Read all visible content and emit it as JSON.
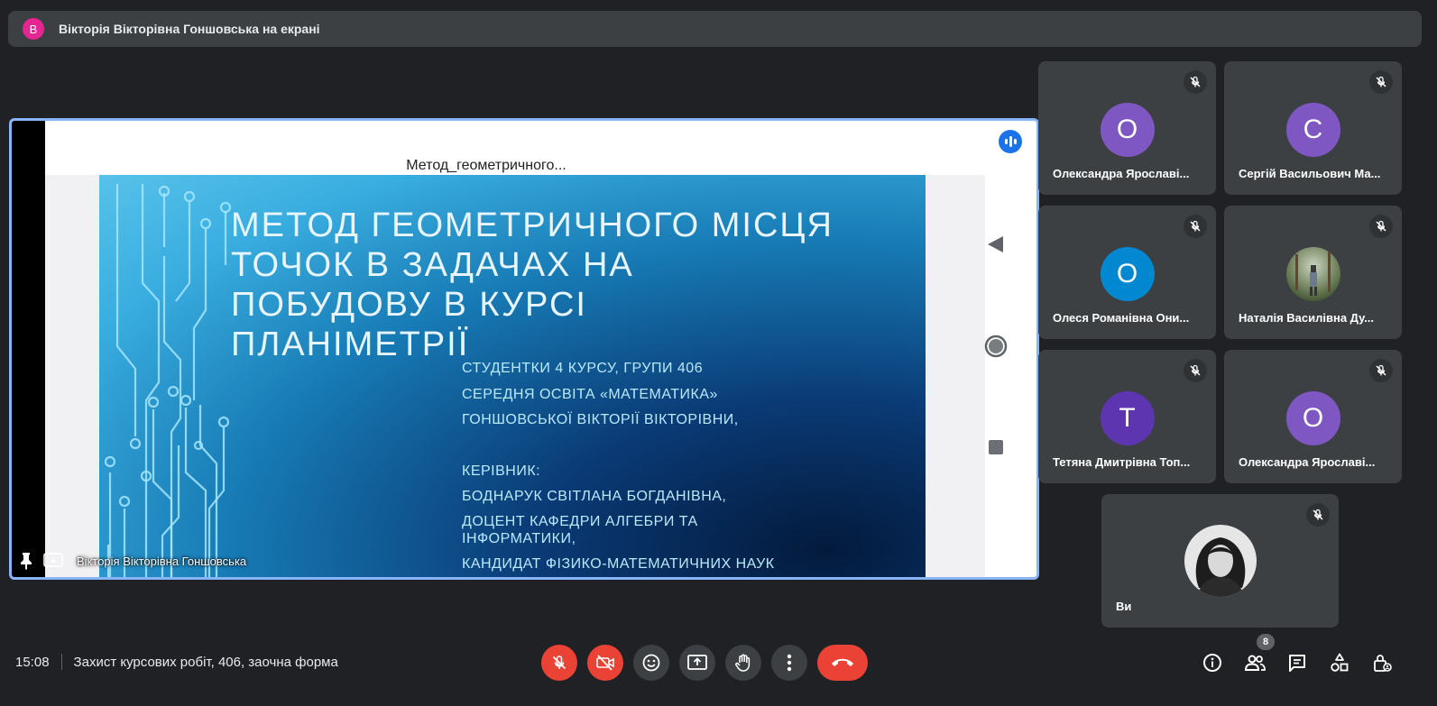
{
  "banner": {
    "avatar_letter": "В",
    "avatar_color": "#e52592",
    "text": "Вікторія Вікторівна Гоншовська на екрані"
  },
  "presentation": {
    "doc_title": "Метод_геометричного...",
    "slide_title_lines": [
      "МЕТОД ГЕОМЕТРИЧНОГО МІСЦЯ",
      "ТОЧОК В ЗАДАЧАХ НА",
      "ПОБУДОВУ В КУРСІ",
      "ПЛАНІМЕТРІЇ"
    ],
    "slide_lines": [
      "СТУДЕНТКИ 4 КУРСУ, ГРУПИ 406",
      "СЕРЕДНЯ ОСВІТА «МАТЕМАТИКА»",
      "ГОНШОВСЬКОЇ ВІКТОРІЇ ВІКТОРІВНИ,",
      "КЕРІВНИК:",
      "БОДНАРУК СВІТЛАНА БОГДАНІВНА,",
      "ДОЦЕНТ КАФЕДРИ АЛГЕБРИ ТА",
      "ІНФОРМАТИКИ,",
      "КАНДИДАТ ФІЗИКО-МАТЕМАТИЧНИХ НАУК"
    ],
    "presenter_name": "Вікторія Вікторівна Гоншовська",
    "highlight_color": "#8ab4f8"
  },
  "participants": [
    {
      "name": "Олександра Ярославі...",
      "initial": "О",
      "color": "#7e57c2",
      "muted": true
    },
    {
      "name": "Сергій Васильович Ма...",
      "initial": "С",
      "color": "#7e57c2",
      "muted": true
    },
    {
      "name": "Олеся Романівна Они...",
      "initial": "О",
      "color": "#0288d1",
      "muted": true
    },
    {
      "name": "Наталія Василівна Ду...",
      "initial": "",
      "photo": true,
      "muted": true
    },
    {
      "name": "Тетяна Дмитрівна Топ...",
      "initial": "Т",
      "color": "#5e35b1",
      "muted": true
    },
    {
      "name": "Олександра Ярославі...",
      "initial": "О",
      "color": "#7e57c2",
      "muted": true
    },
    {
      "name": "Ви",
      "initial": "",
      "photo": true,
      "muted": true
    }
  ],
  "bottom": {
    "time": "15:08",
    "meeting_title": "Захист курсових робіт, 406, заочна форма",
    "participant_count": "8",
    "controls": [
      "mic-off",
      "camera-off",
      "emoji",
      "present-now",
      "raise-hand",
      "more-options",
      "leave-call"
    ],
    "right_icons": [
      "info",
      "people",
      "chat",
      "activities",
      "host-controls"
    ]
  }
}
